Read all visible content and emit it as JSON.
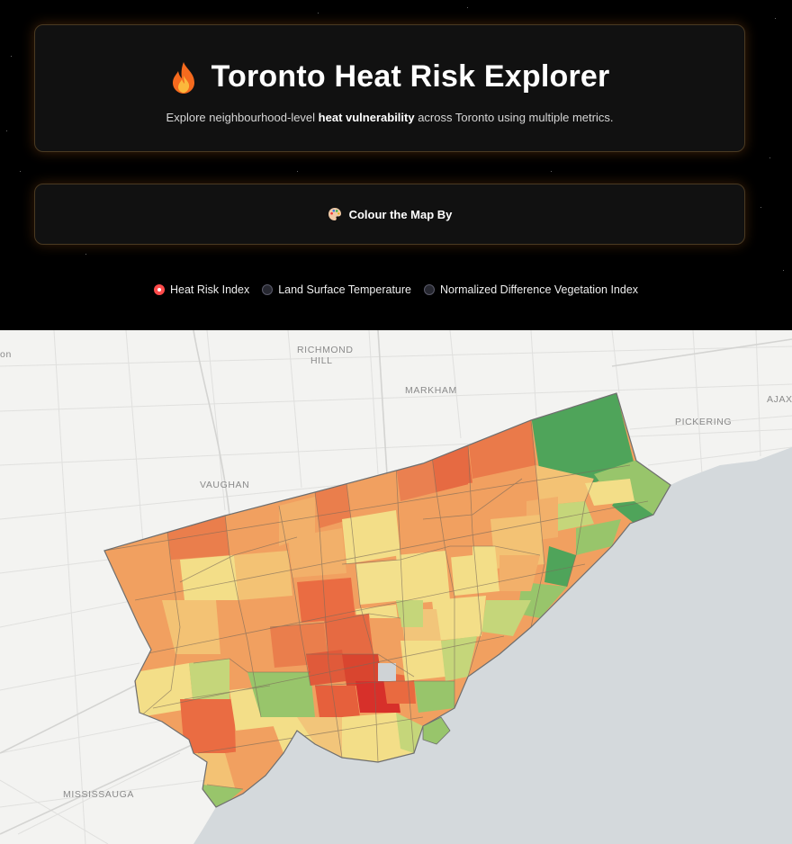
{
  "header": {
    "title": "Toronto Heat Risk Explorer",
    "subtitle_pre": "Explore neighbourhood-level ",
    "subtitle_bold": "heat vulnerability",
    "subtitle_post": " across Toronto using multiple metrics.",
    "icon": "flame-icon"
  },
  "colour_by": {
    "title": "Colour the Map By",
    "icon": "palette-icon"
  },
  "metric_options": [
    {
      "label": "Heat Risk Index",
      "selected": true
    },
    {
      "label": "Land Surface Temperature",
      "selected": false
    },
    {
      "label": "Normalized Difference Vegetation Index",
      "selected": false
    }
  ],
  "map": {
    "place_labels": {
      "richmond": "RICHMOND",
      "hill": "HILL",
      "markham": "MARKHAM",
      "ajax": "AJAX",
      "pickering": "PICKERING",
      "vaughan": "VAUGHAN",
      "mississauga": "MISSISSAUGA",
      "edge_on": "on"
    },
    "colors": {
      "land": "#f3f3f1",
      "water": "#d4d9dc",
      "road": "#dcdcdc",
      "boundary": "#6e6e6e"
    },
    "risk_scale": [
      "#d7302a",
      "#ea6c42",
      "#f1a060",
      "#f2c57a",
      "#f3de88",
      "#c5d67a",
      "#98c56b",
      "#4fa45a"
    ]
  }
}
